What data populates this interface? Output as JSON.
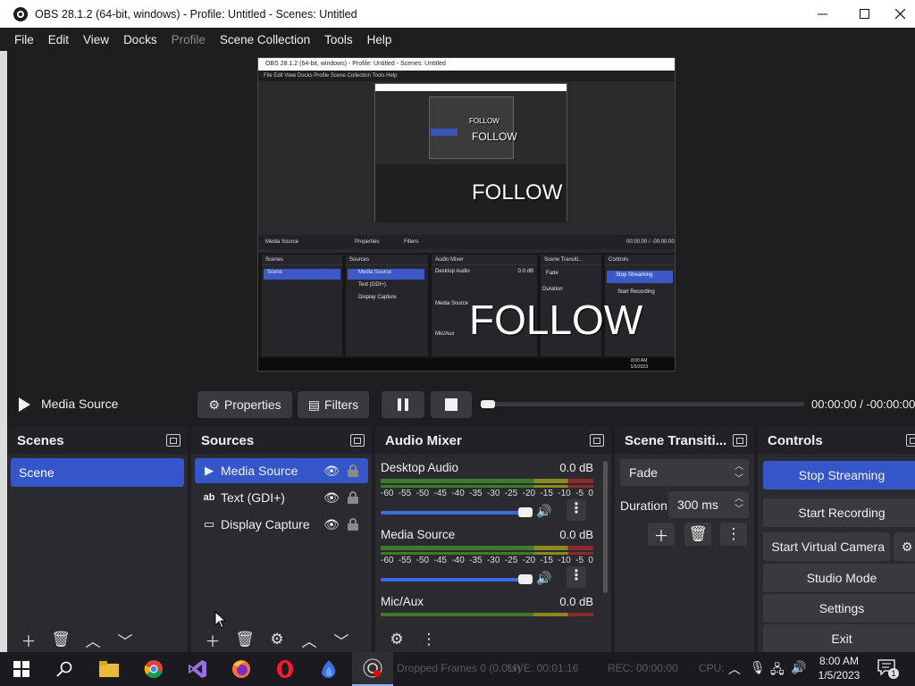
{
  "window": {
    "title": "OBS 28.1.2 (64-bit, windows) - Profile: Untitled - Scenes: Untitled",
    "minimize_icon": "minimize-icon",
    "maximize_icon": "maximize-icon",
    "close_icon": "close-icon"
  },
  "menu": {
    "items": [
      "File",
      "Edit",
      "View",
      "Docks",
      "Profile",
      "Scene Collection",
      "Tools",
      "Help"
    ],
    "disabled": [
      "Profile"
    ]
  },
  "preview": {
    "nested_title": "OBS 28.1.2 (64-bit, windows) - Profile: Untitled - Scenes: Untitled",
    "nested_menu": "File   Edit   View   Docks   Profile   Scene Collection   Tools   Help",
    "follow_text": "FOLLOW",
    "media_source": "Media Source",
    "properties": "Properties",
    "filters": "Filters",
    "timecode": "00:00:00 / -00:00:00",
    "panels": {
      "scenes": "Scenes",
      "sources": "Sources",
      "audio_mixer": "Audio Mixer",
      "scene_transitions": "Scene Transiti...",
      "controls": "Controls",
      "scene": "Scene",
      "sources_list": [
        "Media Source",
        "Text (GDI+)",
        "Display Capture"
      ],
      "desktop_audio": "Desktop Audio",
      "media_source_ch": "Media Source",
      "mic_aux": "Mic/Aux",
      "db": "0.0 dB",
      "fade": "Fade",
      "duration": "Duration",
      "duration_val": "300 ms",
      "stop_streaming": "Stop Streaming",
      "start_recording": "Start Recording",
      "start_virtual": "Start Virtual Camera",
      "studio_mode": "Studio Mode",
      "settings": "Settings",
      "exit": "Exit",
      "clock_time": "8:00 AM",
      "clock_date": "1/5/2023"
    }
  },
  "mediabar": {
    "source_name": "Media Source",
    "properties": "Properties",
    "filters": "Filters",
    "timecode": "00:00:00  /  -00:00:00",
    "progress": 0
  },
  "scenes": {
    "title": "Scenes",
    "items": [
      "Scene"
    ]
  },
  "sources": {
    "title": "Sources",
    "items": [
      {
        "name": "Media Source",
        "icon": "play-icon"
      },
      {
        "name": "Text (GDI+)",
        "icon": "text-icon"
      },
      {
        "name": "Display Capture",
        "icon": "monitor-icon"
      }
    ]
  },
  "audio_mixer": {
    "title": "Audio Mixer",
    "scale": [
      "-60",
      "-55",
      "-50",
      "-45",
      "-40",
      "-35",
      "-30",
      "-25",
      "-20",
      "-15",
      "-10",
      "-5",
      "0"
    ],
    "channels": [
      {
        "name": "Desktop Audio",
        "db": "0.0 dB",
        "volume": 1.0
      },
      {
        "name": "Media Source",
        "db": "0.0 dB",
        "volume": 1.0
      },
      {
        "name": "Mic/Aux",
        "db": "0.0 dB",
        "volume": 1.0
      }
    ]
  },
  "scene_transitions": {
    "title": "Scene Transiti...",
    "transition": "Fade",
    "duration_label": "Duration",
    "duration_value": "300 ms"
  },
  "controls": {
    "title": "Controls",
    "stop_streaming": "Stop Streaming",
    "start_recording": "Start Recording",
    "start_virtual_camera": "Start Virtual Camera",
    "studio_mode": "Studio Mode",
    "settings": "Settings",
    "exit": "Exit"
  },
  "taskbar": {
    "status_dropped": "Dropped Frames 0 (0.0%)",
    "status_live": "LIVE: 00:01:16",
    "status_rec": "REC: 00:00:00",
    "status_cpu": "CPU:",
    "time": "8:00 AM",
    "date": "1/5/2023",
    "notification_count": "1"
  },
  "colors": {
    "accent": "#3556c8",
    "panel_bg": "#2b2b2f",
    "window_bg": "#1e1e20"
  }
}
